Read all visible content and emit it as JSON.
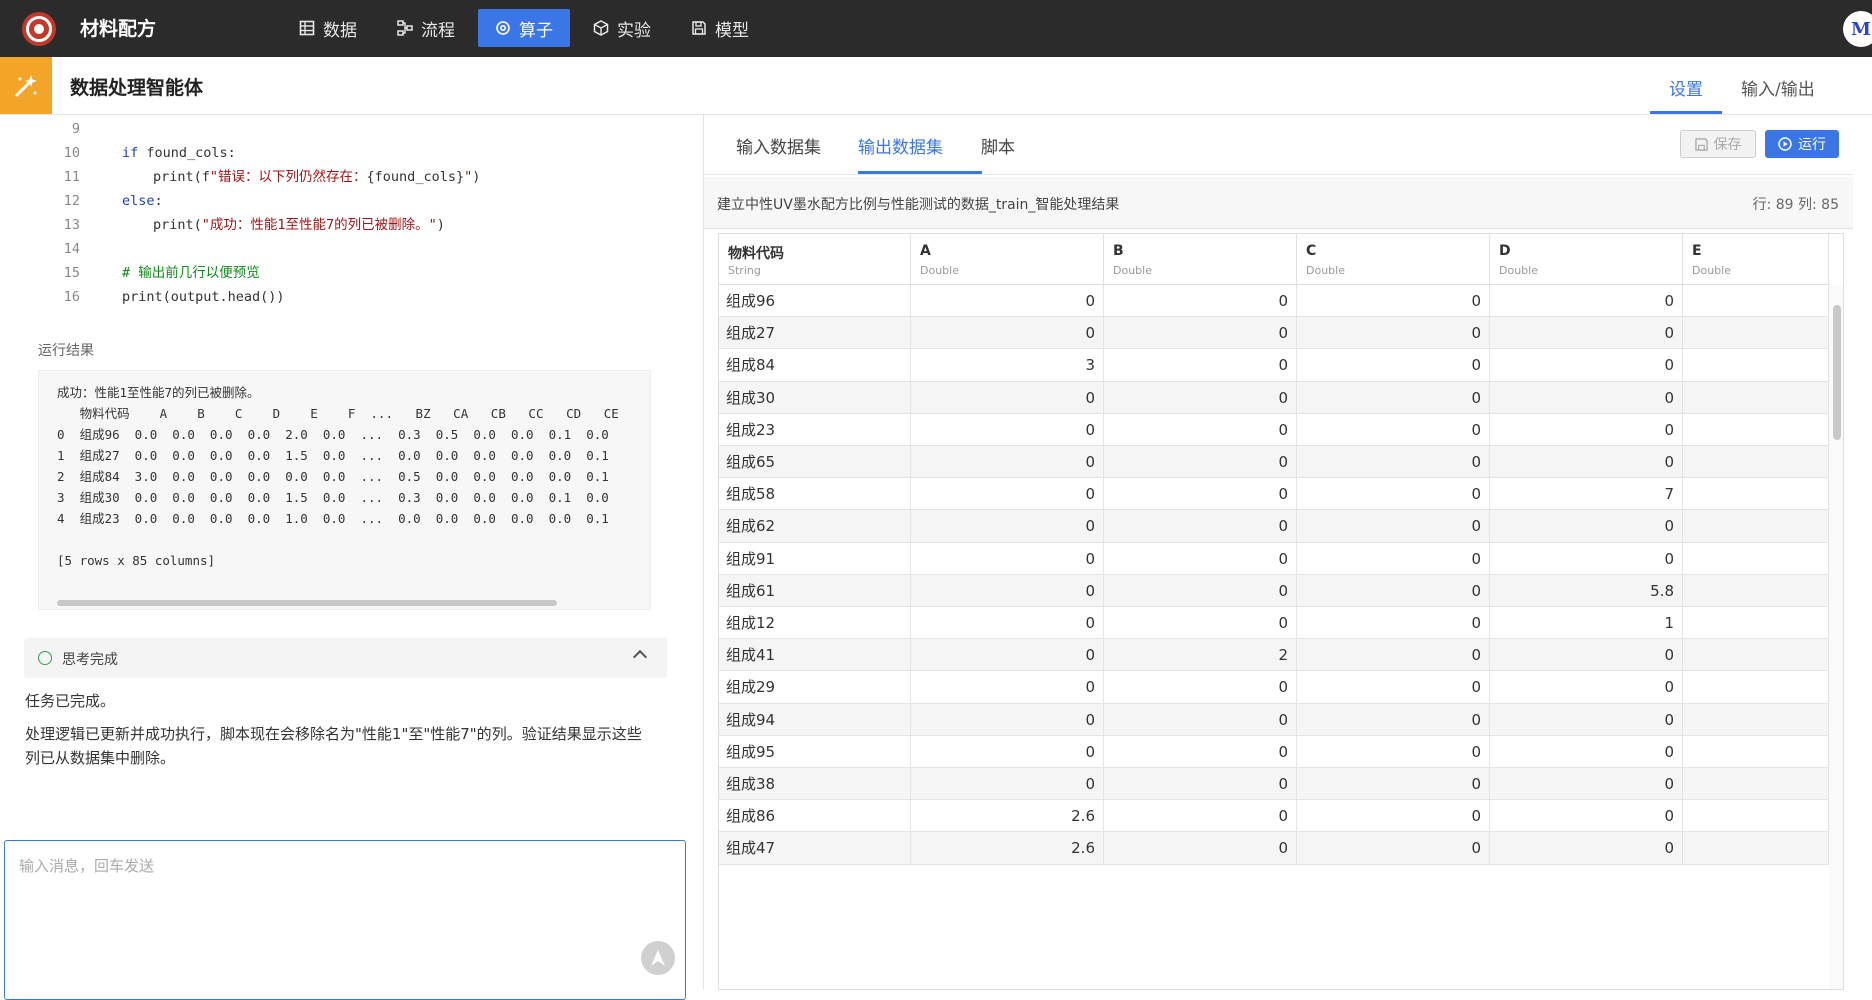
{
  "app": {
    "title": "材料配方",
    "avatar_letter": "M"
  },
  "nav": [
    {
      "label": "数据",
      "icon": "table-icon"
    },
    {
      "label": "流程",
      "icon": "flow-icon"
    },
    {
      "label": "算子",
      "icon": "operator-icon",
      "active": true
    },
    {
      "label": "实验",
      "icon": "cube-icon"
    },
    {
      "label": "模型",
      "icon": "save-model-icon"
    }
  ],
  "subheader": {
    "title": "数据处理智能体",
    "tabs": [
      "设置",
      "输入/输出"
    ]
  },
  "code": {
    "lines": [
      {
        "n": "9",
        "t": ""
      },
      {
        "n": "10",
        "t": "    if found_cols:"
      },
      {
        "n": "11",
        "t": "        print(f\"错误：以下列仍然存在：{found_cols}\")"
      },
      {
        "n": "12",
        "t": "    else:"
      },
      {
        "n": "13",
        "t": "        print(\"成功：性能1至性能7的列已被删除。\")"
      },
      {
        "n": "14",
        "t": ""
      },
      {
        "n": "15",
        "t": "    # 输出前几行以便预览"
      },
      {
        "n": "16",
        "t": "    print(output.head())"
      }
    ]
  },
  "run_result": {
    "label": "运行结果",
    "lines": [
      "成功：性能1至性能7的列已被删除。",
      "   物料代码    A    B    C    D    E    F  ...   BZ   CA   CB   CC   CD   CE",
      "0  组成96  0.0  0.0  0.0  0.0  2.0  0.0  ...  0.3  0.5  0.0  0.0  0.1  0.0",
      "1  组成27  0.0  0.0  0.0  0.0  1.5  0.0  ...  0.0  0.0  0.0  0.0  0.0  0.1",
      "2  组成84  3.0  0.0  0.0  0.0  0.0  0.0  ...  0.5  0.0  0.0  0.0  0.0  0.1",
      "3  组成30  0.0  0.0  0.0  0.0  1.5  0.0  ...  0.3  0.0  0.0  0.0  0.1  0.0",
      "4  组成23  0.0  0.0  0.0  0.0  1.0  0.0  ...  0.0  0.0  0.0  0.0  0.0  0.1",
      "",
      "[5 rows x 85 columns]"
    ]
  },
  "think": {
    "label": "思考完成"
  },
  "messages": [
    "任务已完成。",
    "处理逻辑已更新并成功执行，脚本现在会移除名为\"性能1\"至\"性能7\"的列。验证结果显示这些",
    "列已从数据集中删除。"
  ],
  "chat": {
    "placeholder": "输入消息，回车发送"
  },
  "right_tabs": [
    "输入数据集",
    "输出数据集",
    "脚本"
  ],
  "buttons": {
    "save": "保存",
    "run": "运行"
  },
  "dataset": {
    "name": "建立中性UV墨水配方比例与性能测试的数据_train_智能处理结果",
    "stats": "行: 89 列: 85"
  },
  "table": {
    "columns": [
      {
        "name": "物料代码",
        "type": "String"
      },
      {
        "name": "A",
        "type": "Double"
      },
      {
        "name": "B",
        "type": "Double"
      },
      {
        "name": "C",
        "type": "Double"
      },
      {
        "name": "D",
        "type": "Double"
      },
      {
        "name": "E",
        "type": "Double"
      }
    ],
    "rows": [
      [
        "组成96",
        "0",
        "0",
        "0",
        "0",
        ""
      ],
      [
        "组成27",
        "0",
        "0",
        "0",
        "0",
        ""
      ],
      [
        "组成84",
        "3",
        "0",
        "0",
        "0",
        ""
      ],
      [
        "组成30",
        "0",
        "0",
        "0",
        "0",
        ""
      ],
      [
        "组成23",
        "0",
        "0",
        "0",
        "0",
        ""
      ],
      [
        "组成65",
        "0",
        "0",
        "0",
        "0",
        ""
      ],
      [
        "组成58",
        "0",
        "0",
        "0",
        "7",
        ""
      ],
      [
        "组成62",
        "0",
        "0",
        "0",
        "0",
        ""
      ],
      [
        "组成91",
        "0",
        "0",
        "0",
        "0",
        ""
      ],
      [
        "组成61",
        "0",
        "0",
        "0",
        "5.8",
        ""
      ],
      [
        "组成12",
        "0",
        "0",
        "0",
        "1",
        ""
      ],
      [
        "组成41",
        "0",
        "2",
        "0",
        "0",
        ""
      ],
      [
        "组成29",
        "0",
        "0",
        "0",
        "0",
        ""
      ],
      [
        "组成94",
        "0",
        "0",
        "0",
        "0",
        ""
      ],
      [
        "组成95",
        "0",
        "0",
        "0",
        "0",
        ""
      ],
      [
        "组成38",
        "0",
        "0",
        "0",
        "0",
        ""
      ],
      [
        "组成86",
        "2.6",
        "0",
        "0",
        "0",
        ""
      ],
      [
        "组成47",
        "2.6",
        "0",
        "0",
        "0",
        ""
      ]
    ]
  }
}
